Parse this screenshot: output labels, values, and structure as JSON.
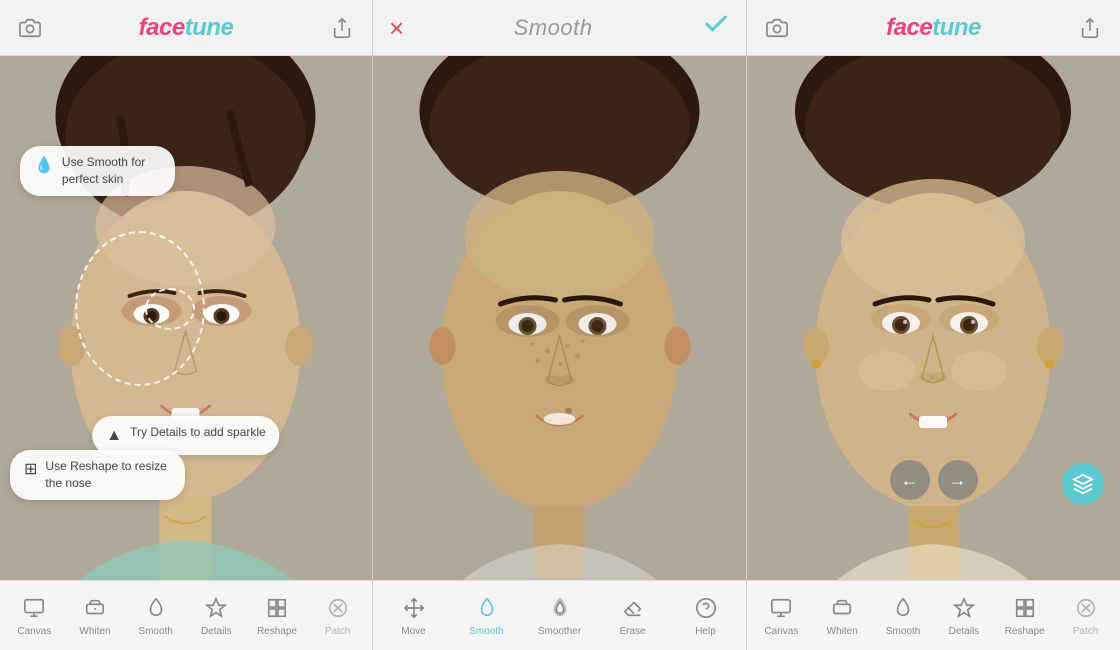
{
  "panels": {
    "left": {
      "header": {
        "logo_face": "face",
        "logo_tune": "tune",
        "camera_icon": "camera",
        "share_icon": "share"
      },
      "toolbar": {
        "items": [
          {
            "id": "canvas",
            "label": "Canvas",
            "icon": "canvas"
          },
          {
            "id": "whiten",
            "label": "Whiten",
            "icon": "whiten"
          },
          {
            "id": "smooth",
            "label": "Smooth",
            "icon": "smooth"
          },
          {
            "id": "details",
            "label": "Details",
            "icon": "details"
          },
          {
            "id": "reshape",
            "label": "Reshape",
            "icon": "reshape"
          },
          {
            "id": "patch",
            "label": "Patch",
            "icon": "patch"
          }
        ]
      },
      "tutorials": [
        {
          "text": "Use Smooth for perfect skin",
          "icon": "droplet"
        },
        {
          "text": "Try Details to add sparkle",
          "icon": "triangle"
        },
        {
          "text": "Use Reshape to resize the nose",
          "icon": "grid"
        }
      ]
    },
    "center": {
      "header": {
        "cancel_label": "×",
        "title": "Smooth",
        "confirm_label": "✓"
      },
      "toolbar": {
        "items": [
          {
            "id": "move",
            "label": "Move",
            "icon": "move"
          },
          {
            "id": "smooth",
            "label": "Smooth",
            "icon": "smooth",
            "active": true
          },
          {
            "id": "smoother",
            "label": "Smoother",
            "icon": "smoother"
          },
          {
            "id": "erase",
            "label": "Erase",
            "icon": "erase"
          },
          {
            "id": "help",
            "label": "Help",
            "icon": "help"
          }
        ]
      }
    },
    "right": {
      "header": {
        "logo_face": "face",
        "logo_tune": "tune",
        "camera_icon": "camera",
        "share_icon": "share"
      },
      "nav_arrows": {
        "back_icon": "←",
        "forward_icon": "→"
      },
      "action_button": {
        "icon": "layers"
      },
      "toolbar": {
        "items": [
          {
            "id": "canvas",
            "label": "Canvas",
            "icon": "canvas"
          },
          {
            "id": "whiten",
            "label": "Whiten",
            "icon": "whiten"
          },
          {
            "id": "smooth",
            "label": "Smooth",
            "icon": "smooth"
          },
          {
            "id": "details",
            "label": "Details",
            "icon": "details"
          },
          {
            "id": "reshape",
            "label": "Reshape",
            "icon": "reshape"
          },
          {
            "id": "patch",
            "label": "Patch",
            "icon": "patch"
          }
        ]
      }
    }
  },
  "colors": {
    "brand_pink": "#f0427a",
    "brand_teal": "#5cc8d0",
    "cancel_red": "#e05050",
    "gray_text": "#888888",
    "toolbar_bg": "#f5f5f5",
    "header_bg": "#f2f2f2"
  }
}
